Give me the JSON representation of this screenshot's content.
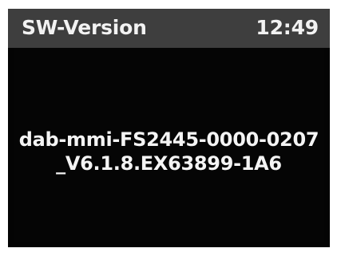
{
  "header": {
    "title": "SW-Version",
    "clock": "12:49"
  },
  "content": {
    "version_line_1": "dab-mmi-FS2445-0000-0207",
    "version_line_2": "_V6.1.8.EX63899-1A6"
  },
  "colors": {
    "screen_background": "#050505",
    "header_background": "#3e3e3e",
    "text": "#f2f2f2"
  }
}
